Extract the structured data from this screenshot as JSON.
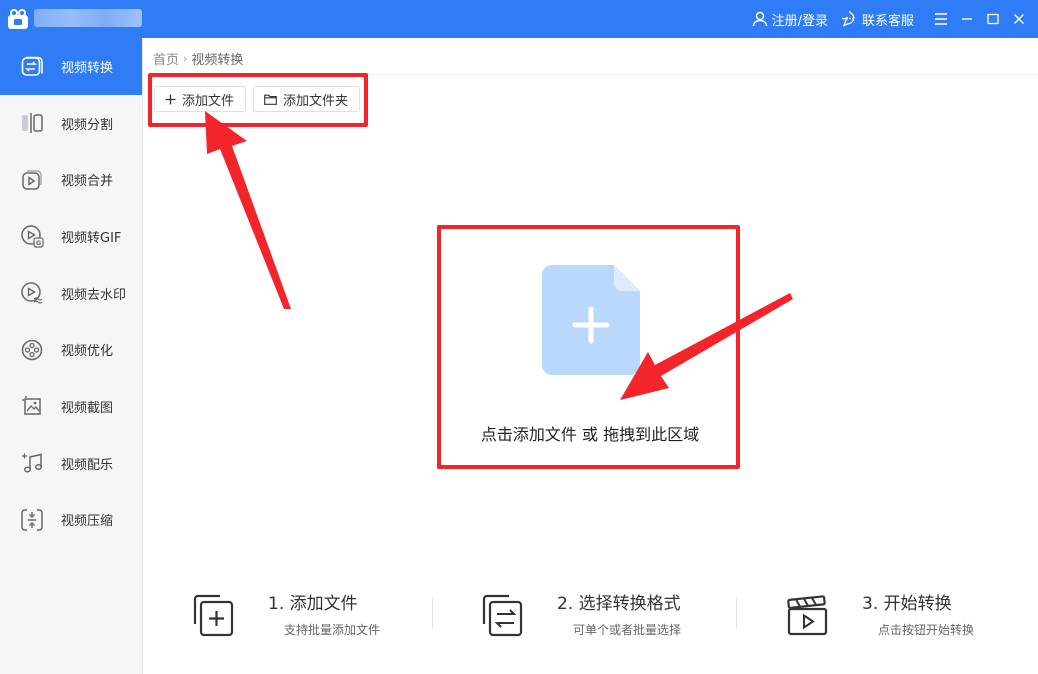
{
  "window": {
    "user_link": "注册/登录",
    "service_link": "联系客服"
  },
  "sidebar": {
    "items": [
      {
        "label": "视频转换",
        "icon": "convert-icon",
        "active": true
      },
      {
        "label": "视频分割",
        "icon": "split-icon"
      },
      {
        "label": "视频合并",
        "icon": "merge-icon"
      },
      {
        "label": "视频转GIF",
        "icon": "gif-icon"
      },
      {
        "label": "视频去水印",
        "icon": "watermark-icon"
      },
      {
        "label": "视频优化",
        "icon": "optimize-icon"
      },
      {
        "label": "视频截图",
        "icon": "screenshot-icon"
      },
      {
        "label": "视频配乐",
        "icon": "music-icon"
      },
      {
        "label": "视频压缩",
        "icon": "compress-icon"
      }
    ]
  },
  "breadcrumb": {
    "home": "首页",
    "current": "视频转换"
  },
  "toolbar": {
    "add_file": "添加文件",
    "add_folder": "添加文件夹"
  },
  "dropzone": {
    "text": "点击添加文件 或 拖拽到此区域"
  },
  "steps": [
    {
      "title": "1. 添加文件",
      "desc": "支持批量添加文件"
    },
    {
      "title": "2. 选择转换格式",
      "desc": "可单个或者批量选择"
    },
    {
      "title": "3. 开始转换",
      "desc": "点击按钮开始转换"
    }
  ],
  "colors": {
    "accent": "#2f7cf6",
    "annotation": "#f3242a",
    "file_icon": "#b9d8fb"
  }
}
